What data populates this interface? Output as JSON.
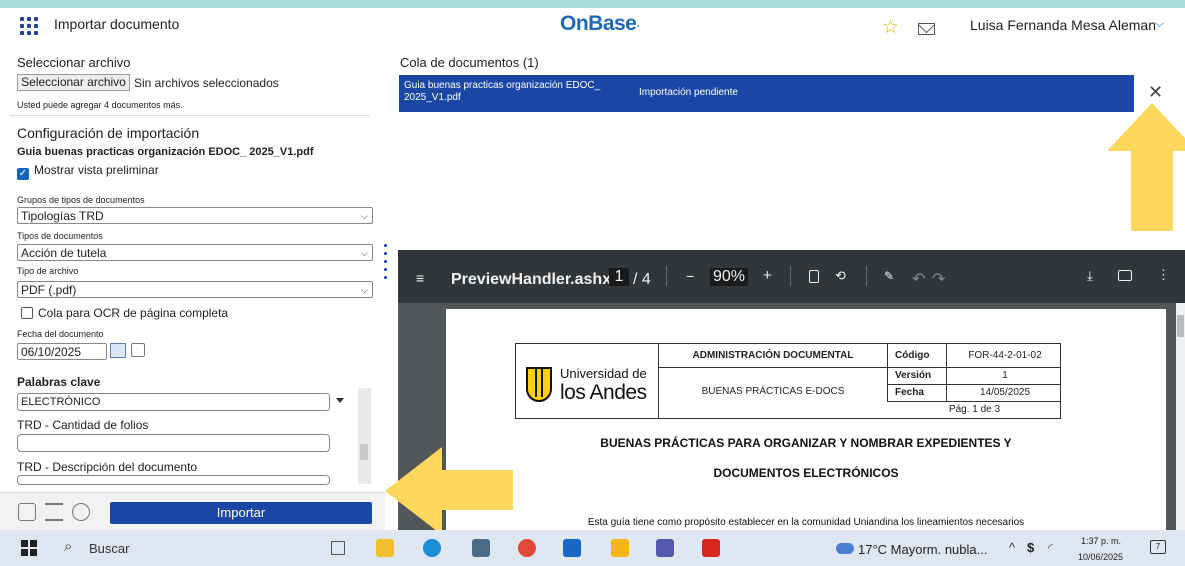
{
  "app": {
    "title": "Importar documento",
    "logo": "OnBase",
    "logo_mark": "·",
    "user": "Luisa Fernanda Mesa Aleman",
    "caret": "⌵"
  },
  "left": {
    "select_heading": "Seleccionar archivo",
    "select_button": "Seleccionar archivo",
    "no_files": "Sin archivos seleccionados",
    "hint": "Usted puede agregar 4 documentos más.",
    "config_heading": "Configuración de importación",
    "file_name": "Guia buenas practicas organización EDOC_ 2025_V1.pdf",
    "preview_label": "Mostrar vista preliminar",
    "preview_checked": true,
    "groups_label": "Grupos de tipos de documentos",
    "groups_value": "Tipologías TRD",
    "types_label": "Tipos de documentos",
    "types_value": "Acción de tutela",
    "filetype_label": "Tipo de archivo",
    "filetype_value": "PDF (.pdf)",
    "ocr_label": "Cola para OCR de página completa",
    "date_label": "Fecha del documento",
    "date_value": "06/10/2025",
    "keywords_heading": "Palabras clave",
    "keyword_value": "ELECTRÓNICO",
    "folios_label": "TRD - Cantidad de folios",
    "desc_label": "TRD - Descripción del documento",
    "import_button": "Importar"
  },
  "queue": {
    "title": "Cola de documentos (1)",
    "file": "Guia buenas practicas organización EDOC_ 2025_V1.pdf",
    "status": "Importación pendiente",
    "close": "✕"
  },
  "pdf": {
    "filename": "PreviewHandler.ashx",
    "page_current": "1",
    "page_total": "/ 4",
    "zoom": "90%",
    "table": {
      "dept": "ADMINISTRACIÓN DOCUMENTAL",
      "doc": "BUENAS PRÁCTICAS E-DOCS",
      "code_label": "Código",
      "code_value": "FOR-44-2-01-02",
      "version_label": "Versión",
      "version_value": "1",
      "date_label": "Fecha",
      "date_value": "14/05/2025",
      "page": "Pág. 1 de 3"
    },
    "univ_line1": "Universidad de",
    "univ_line2": "los Andes",
    "heading1": "BUENAS PRÁCTICAS PARA ORGANIZAR Y NOMBRAR EXPEDIENTES Y",
    "heading2": "DOCUMENTOS ELECTRÓNICOS",
    "body": "Esta guía tiene como propósito establecer en la comunidad Uniandina los lineamientos necesarios"
  },
  "taskbar": {
    "search": "Buscar",
    "weather": "17°C  Mayorm. nubla...",
    "time": "1:37 p. m.",
    "date": "10/06/2025",
    "notif_count": "7"
  },
  "colors": {
    "accent": "#1a47a6",
    "arrow": "#fdd85d",
    "topstrip": "#a9dadc",
    "pdf_toolbar": "#323639"
  }
}
